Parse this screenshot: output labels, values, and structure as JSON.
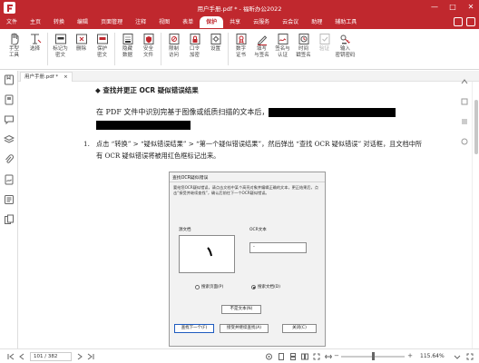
{
  "app": {
    "window_title": "用户手册.pdf * - 福昕办公2022",
    "brand_color": "#c0282e"
  },
  "menubar": {
    "items": [
      "文件",
      "主页",
      "转换",
      "编辑",
      "页面管理",
      "注释",
      "视图",
      "表单",
      "保护",
      "共享",
      "云服务",
      "云会议",
      "助理",
      "辅助工具"
    ],
    "active": "保护"
  },
  "ribbon": {
    "tools": [
      {
        "icon": "hand-icon",
        "label": "手型\n工具"
      },
      {
        "icon": "select-text-icon",
        "label": "选择"
      },
      {
        "icon": "mark-redaction-icon",
        "label": "标记为\n密文"
      },
      {
        "icon": "delete-icon",
        "label": "删除"
      },
      {
        "icon": "protect-icon",
        "label": "保护\n密文"
      },
      {
        "icon": "hidden-data-icon",
        "label": "隐藏\n数据"
      },
      {
        "icon": "security-icon",
        "label": "安全\n文件"
      },
      {
        "icon": "restrict-access-icon",
        "label": "限制\n访问"
      },
      {
        "icon": "password-encrypt-icon",
        "label": "口令\n加密"
      },
      {
        "icon": "settings-icon",
        "label": "设置"
      },
      {
        "icon": "certificate-icon",
        "label": "数字\n证书"
      },
      {
        "icon": "fill-sign-icon",
        "label": "填写\n与签名"
      },
      {
        "icon": "sign-cert-icon",
        "label": "签名与\n认证"
      },
      {
        "icon": "timestamp-icon",
        "label": "时间\n戳签名"
      },
      {
        "icon": "validate-icon",
        "label": "验证",
        "disabled": true
      },
      {
        "icon": "key-icon",
        "label": "输入\n密钥密码"
      }
    ]
  },
  "tab": {
    "label": "用户手册.pdf *",
    "close": "×"
  },
  "document": {
    "section_heading": "◆   查找并更正 OCR 疑似错误结果",
    "para_prefix": "在 PDF 文件中识别完基于图像或纸质扫描的文本后，",
    "step_number": "1.",
    "step_text": "点击 “转换” > “疑似错误结果” > “第一个疑似错误结果”，然后弹出 “查找 OCR 疑似错误” 对话框，且文档中所有 OCR 疑似错误将被用红色框标记出来。"
  },
  "dialog": {
    "title": "查找OCR疑似错误",
    "description": "要给您OCR疑似错误，请点击文档中某个高亮对象并编辑正确的文本，更正结果后，点击“接受并继续查找”，确认后前往下一个OCR疑似错误。",
    "source_label": "源文档",
    "ocr_label": "OCR文本",
    "ocr_value": "-",
    "radio_page": "搜索页面(P)",
    "radio_doc": "搜索文档(D)",
    "radio_selected": "doc",
    "btn_not_text": "不是文本(N)",
    "btn_find_next": "查找下一个(F)",
    "btn_accept": "接受并继续查找(A)",
    "btn_close": "关闭(C)"
  },
  "statusbar": {
    "page": "101 / 382",
    "zoom": "115.64%",
    "minus": "−",
    "plus": "+"
  }
}
